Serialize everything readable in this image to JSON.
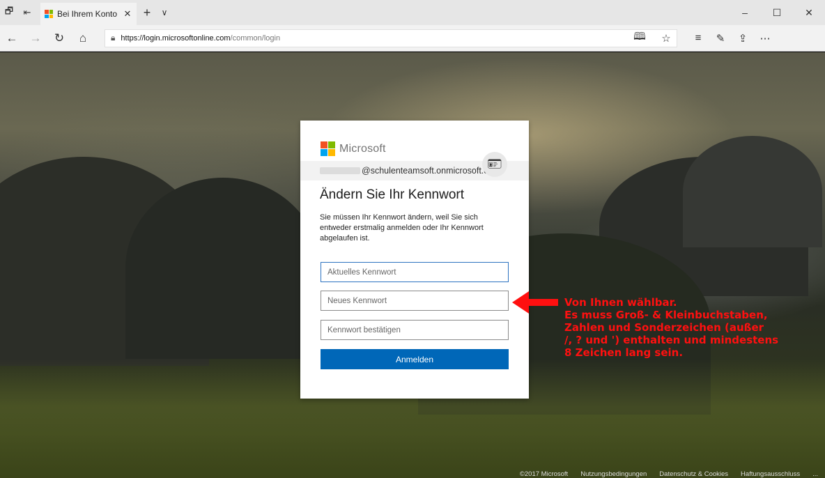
{
  "browser": {
    "tab_title": "Bei Ihrem Konto anmelc",
    "url_host": "https://login.microsoftonline.com",
    "url_path": "/common/login"
  },
  "login": {
    "brand": "Microsoft",
    "account": "@schulenteamsoft.onmicrosoft.c...",
    "title": "Ändern Sie Ihr Kennwort",
    "description": "Sie müssen Ihr Kennwort ändern, weil Sie sich entweder erstmalig anmelden oder Ihr Kennwort abgelaufen ist.",
    "current_password_placeholder": "Aktuelles Kennwort",
    "new_password_placeholder": "Neues Kennwort",
    "confirm_password_placeholder": "Kennwort bestätigen",
    "submit_label": "Anmelden"
  },
  "annotation": {
    "lines": [
      "Von Ihnen wählbar.",
      "Es muss Groß- & Kleinbuchstaben,",
      "Zahlen und Sonderzeichen (außer",
      " /, ? und ') enthalten und mindestens",
      "8 Zeichen lang sein."
    ],
    "color": "#ff1010"
  },
  "footer": {
    "copyright": "©2017 Microsoft",
    "terms": "Nutzungsbedingungen",
    "privacy": "Datenschutz & Cookies",
    "disclaimer": "Haftungsausschluss",
    "more": "..."
  },
  "colors": {
    "accent": "#0067b8",
    "focus_border": "#2b72c0",
    "ms_red": "#f25022",
    "ms_green": "#7fba00",
    "ms_blue": "#00a4ef",
    "ms_yellow": "#ffb900"
  },
  "icons": [
    "tab-preview-icon",
    "set-aside-tabs-icon",
    "close-icon",
    "new-tab-icon",
    "chevron-down-icon",
    "minimize-icon",
    "maximize-icon",
    "back-icon",
    "forward-icon",
    "refresh-icon",
    "home-icon",
    "lock-icon",
    "reading-view-icon",
    "favorite-star-icon",
    "favorites-hub-icon",
    "pen-icon",
    "share-icon",
    "more-icon",
    "badge-icon"
  ]
}
